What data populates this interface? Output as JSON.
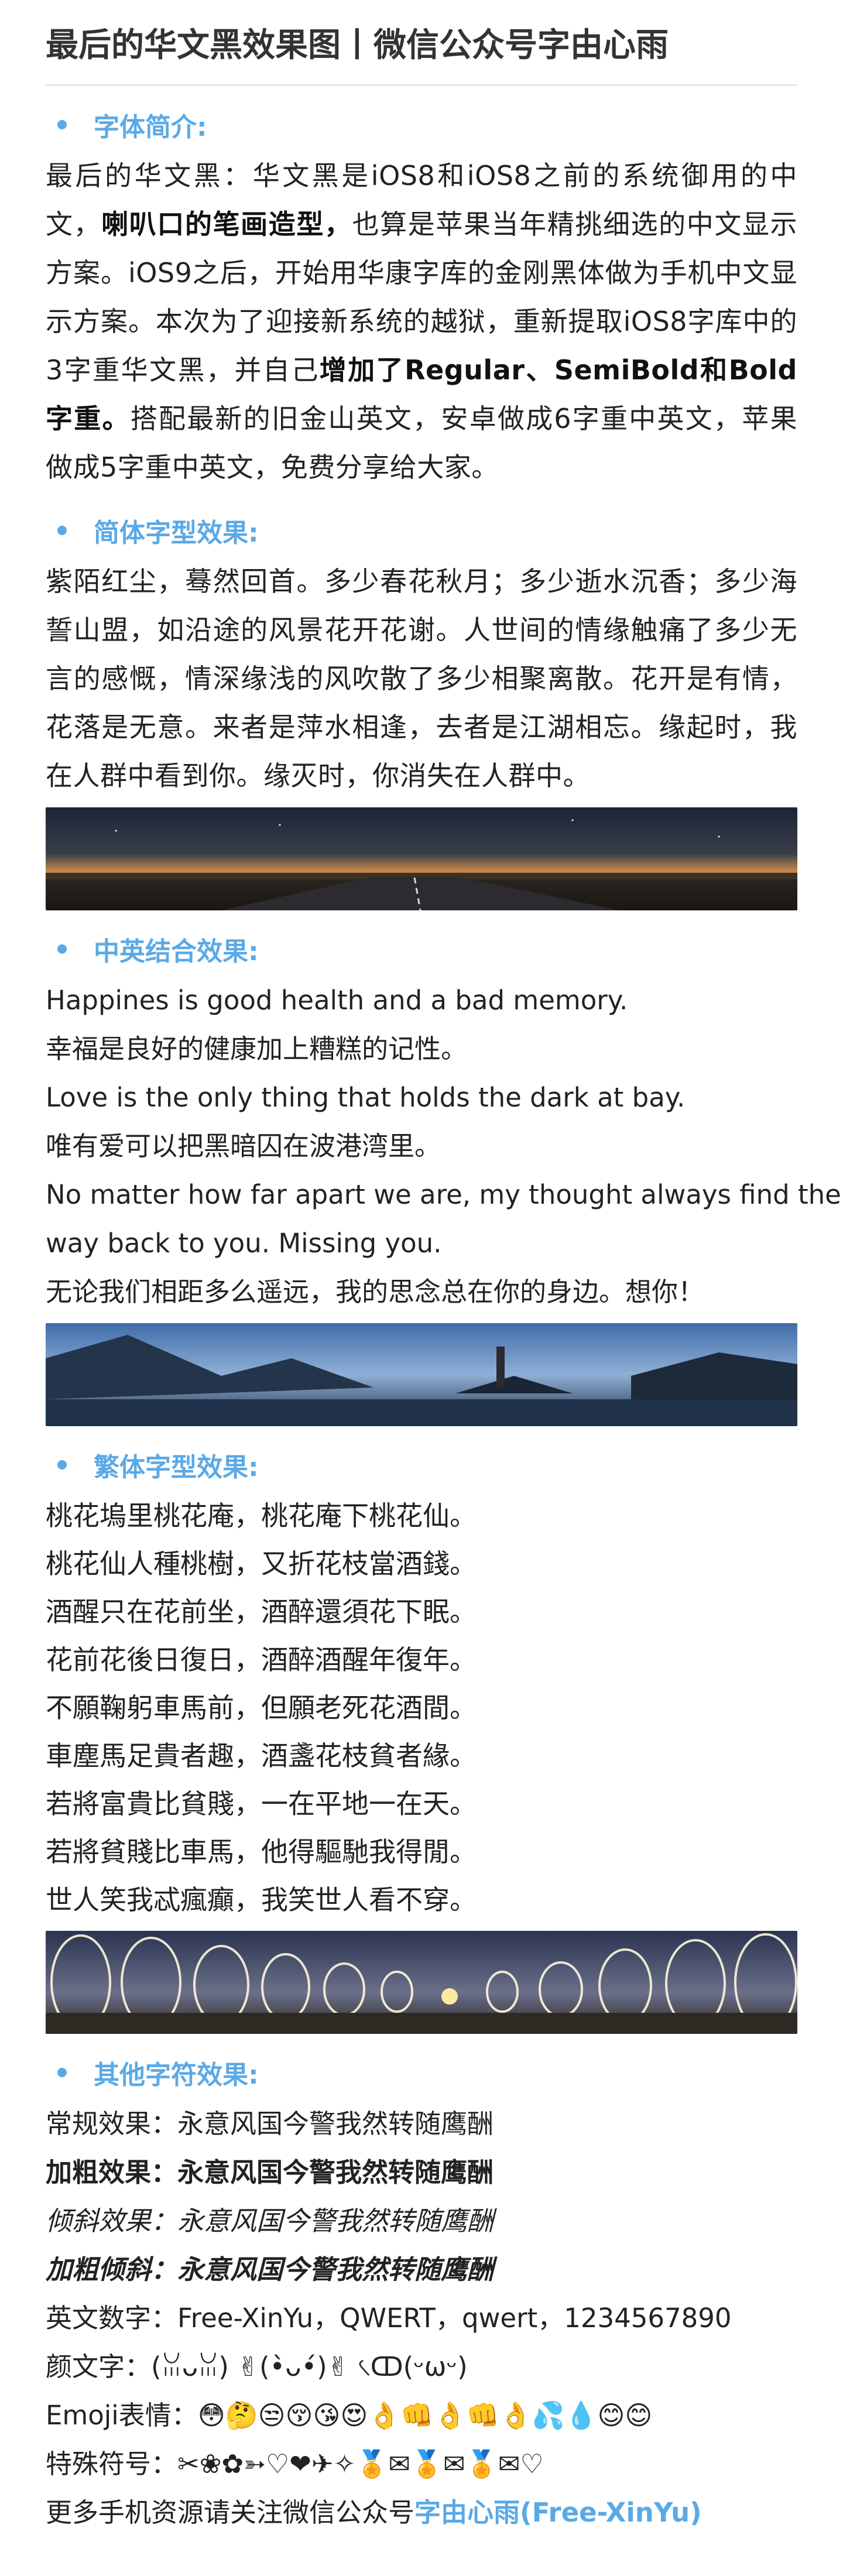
{
  "title": "最后的华文黑效果图丨微信公众号字由心雨",
  "sections": {
    "intro": {
      "heading": "字体简介:",
      "p1": "最后的华文黑：华文黑是iOS8和iOS8之前的系统御用的中文，",
      "bold1": "喇叭口的笔画造型，",
      "p2": "也算是苹果当年精挑细选的中文显示方案。iOS9之后，开始用华康字库的金刚黑体做为手机中文显示方案。本次为了迎接新系统的越狱，重新提取iOS8字库中的3字重华文黑，并自己",
      "bold2": "增加了Regular、SemiBold和Bold字重。",
      "p3": "搭配最新的旧金山英文，安卓做成6字重中英文，苹果做成5字重中英文，免费分享给大家。"
    },
    "simplified": {
      "heading": "简体字型效果:",
      "text": "紫陌红尘，蓦然回首。多少春花秋月；多少逝水沉香；多少海誓山盟，如沿途的风景花开花谢。人世间的情缘触痛了多少无言的感慨，情深缘浅的风吹散了多少相聚离散。花开是有情，花落是无意。来者是萍水相逢，去者是江湖相忘。缘起时，我在人群中看到你。缘灭时，你消失在人群中。"
    },
    "mixed": {
      "heading": "中英结合效果:",
      "lines": [
        "Happines is good health and a bad memory.",
        "幸福是良好的健康加上糟糕的记性。",
        "Love is the only thing that holds the dark at bay.",
        "唯有爱可以把黑暗囚在波港湾里。",
        "No matter how far apart we are, my thought always find their",
        "way back to you. Missing you.",
        "无论我们相距多么遥远，我的思念总在你的身边。想你！"
      ]
    },
    "traditional": {
      "heading": "繁体字型效果:",
      "lines": [
        "桃花塢里桃花庵，桃花庵下桃花仙。",
        "桃花仙人種桃樹，又折花枝當酒錢。",
        "酒醒只在花前坐，酒醉還須花下眠。",
        "花前花後日復日，酒醉酒醒年復年。",
        "不願鞠躬車馬前，但願老死花酒間。",
        "車塵馬足貴者趣，酒盞花枝貧者緣。",
        "若將富貴比貧賤，一在平地一在天。",
        "若將貧賤比車馬，他得驅馳我得閒。",
        "世人笑我忒瘋癲，我笑世人看不穿。"
      ]
    },
    "other": {
      "heading": "其他字符效果:",
      "regular_label": "常规效果：",
      "regular_text": "永意风国今警我然转随鹰酬",
      "bold_label": "加粗效果：",
      "bold_text": "永意风国今警我然转随鹰酬",
      "italic_label": "倾斜效果：",
      "italic_text": "永意风国今警我然转随鹰酬",
      "bolditalic_label": "加粗倾斜：",
      "bolditalic_text": "永意风国今警我然转随鹰酬",
      "english_label": "英文数字：",
      "english_text": "Free-XinYu，QWERT，qwert，1234567890",
      "kaomoji_label": "颜文字：",
      "kaomoji_text": "(ꈍᴗꈍ)  ✌(•̀ᴗ•́)✌  ৻ↀ(ᵕωᵕ)",
      "emoji_label": "Emoji表情：",
      "emoji_text": "😳🤔😒😚😘😍👌👊👌👊👌💦💧😊😊",
      "special_label": "特殊符号：",
      "special_text": "✂❀✿➳♡❤✈✧🏅✉🏅✉🏅✉♡",
      "footer_prefix": "更多手机资源请关注微信公众号",
      "footer_link": "字由心雨(Free-XinYu)"
    }
  },
  "colors": {
    "accent": "#5aa9e6",
    "text": "#222222"
  }
}
